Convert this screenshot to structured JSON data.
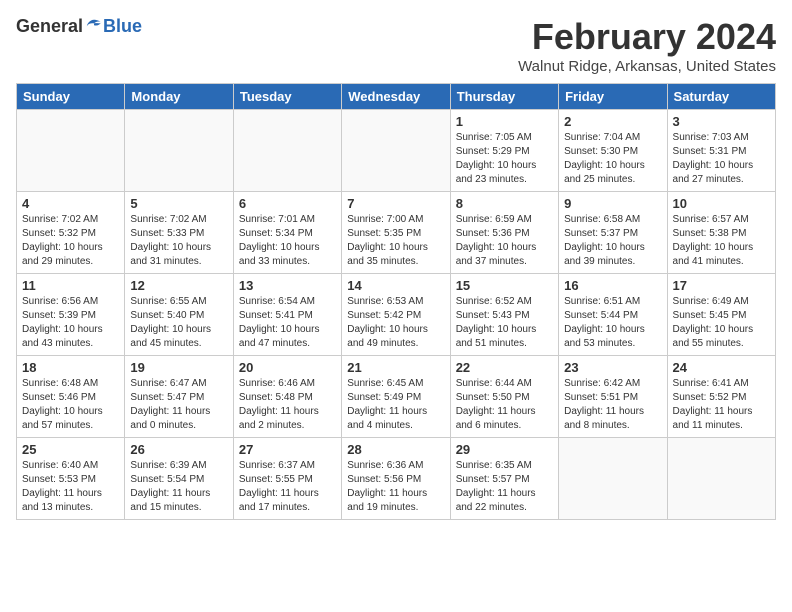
{
  "header": {
    "logo_general": "General",
    "logo_blue": "Blue",
    "month": "February 2024",
    "location": "Walnut Ridge, Arkansas, United States"
  },
  "weekdays": [
    "Sunday",
    "Monday",
    "Tuesday",
    "Wednesday",
    "Thursday",
    "Friday",
    "Saturday"
  ],
  "weeks": [
    [
      {
        "day": "",
        "info": ""
      },
      {
        "day": "",
        "info": ""
      },
      {
        "day": "",
        "info": ""
      },
      {
        "day": "",
        "info": ""
      },
      {
        "day": "1",
        "info": "Sunrise: 7:05 AM\nSunset: 5:29 PM\nDaylight: 10 hours\nand 23 minutes."
      },
      {
        "day": "2",
        "info": "Sunrise: 7:04 AM\nSunset: 5:30 PM\nDaylight: 10 hours\nand 25 minutes."
      },
      {
        "day": "3",
        "info": "Sunrise: 7:03 AM\nSunset: 5:31 PM\nDaylight: 10 hours\nand 27 minutes."
      }
    ],
    [
      {
        "day": "4",
        "info": "Sunrise: 7:02 AM\nSunset: 5:32 PM\nDaylight: 10 hours\nand 29 minutes."
      },
      {
        "day": "5",
        "info": "Sunrise: 7:02 AM\nSunset: 5:33 PM\nDaylight: 10 hours\nand 31 minutes."
      },
      {
        "day": "6",
        "info": "Sunrise: 7:01 AM\nSunset: 5:34 PM\nDaylight: 10 hours\nand 33 minutes."
      },
      {
        "day": "7",
        "info": "Sunrise: 7:00 AM\nSunset: 5:35 PM\nDaylight: 10 hours\nand 35 minutes."
      },
      {
        "day": "8",
        "info": "Sunrise: 6:59 AM\nSunset: 5:36 PM\nDaylight: 10 hours\nand 37 minutes."
      },
      {
        "day": "9",
        "info": "Sunrise: 6:58 AM\nSunset: 5:37 PM\nDaylight: 10 hours\nand 39 minutes."
      },
      {
        "day": "10",
        "info": "Sunrise: 6:57 AM\nSunset: 5:38 PM\nDaylight: 10 hours\nand 41 minutes."
      }
    ],
    [
      {
        "day": "11",
        "info": "Sunrise: 6:56 AM\nSunset: 5:39 PM\nDaylight: 10 hours\nand 43 minutes."
      },
      {
        "day": "12",
        "info": "Sunrise: 6:55 AM\nSunset: 5:40 PM\nDaylight: 10 hours\nand 45 minutes."
      },
      {
        "day": "13",
        "info": "Sunrise: 6:54 AM\nSunset: 5:41 PM\nDaylight: 10 hours\nand 47 minutes."
      },
      {
        "day": "14",
        "info": "Sunrise: 6:53 AM\nSunset: 5:42 PM\nDaylight: 10 hours\nand 49 minutes."
      },
      {
        "day": "15",
        "info": "Sunrise: 6:52 AM\nSunset: 5:43 PM\nDaylight: 10 hours\nand 51 minutes."
      },
      {
        "day": "16",
        "info": "Sunrise: 6:51 AM\nSunset: 5:44 PM\nDaylight: 10 hours\nand 53 minutes."
      },
      {
        "day": "17",
        "info": "Sunrise: 6:49 AM\nSunset: 5:45 PM\nDaylight: 10 hours\nand 55 minutes."
      }
    ],
    [
      {
        "day": "18",
        "info": "Sunrise: 6:48 AM\nSunset: 5:46 PM\nDaylight: 10 hours\nand 57 minutes."
      },
      {
        "day": "19",
        "info": "Sunrise: 6:47 AM\nSunset: 5:47 PM\nDaylight: 11 hours\nand 0 minutes."
      },
      {
        "day": "20",
        "info": "Sunrise: 6:46 AM\nSunset: 5:48 PM\nDaylight: 11 hours\nand 2 minutes."
      },
      {
        "day": "21",
        "info": "Sunrise: 6:45 AM\nSunset: 5:49 PM\nDaylight: 11 hours\nand 4 minutes."
      },
      {
        "day": "22",
        "info": "Sunrise: 6:44 AM\nSunset: 5:50 PM\nDaylight: 11 hours\nand 6 minutes."
      },
      {
        "day": "23",
        "info": "Sunrise: 6:42 AM\nSunset: 5:51 PM\nDaylight: 11 hours\nand 8 minutes."
      },
      {
        "day": "24",
        "info": "Sunrise: 6:41 AM\nSunset: 5:52 PM\nDaylight: 11 hours\nand 11 minutes."
      }
    ],
    [
      {
        "day": "25",
        "info": "Sunrise: 6:40 AM\nSunset: 5:53 PM\nDaylight: 11 hours\nand 13 minutes."
      },
      {
        "day": "26",
        "info": "Sunrise: 6:39 AM\nSunset: 5:54 PM\nDaylight: 11 hours\nand 15 minutes."
      },
      {
        "day": "27",
        "info": "Sunrise: 6:37 AM\nSunset: 5:55 PM\nDaylight: 11 hours\nand 17 minutes."
      },
      {
        "day": "28",
        "info": "Sunrise: 6:36 AM\nSunset: 5:56 PM\nDaylight: 11 hours\nand 19 minutes."
      },
      {
        "day": "29",
        "info": "Sunrise: 6:35 AM\nSunset: 5:57 PM\nDaylight: 11 hours\nand 22 minutes."
      },
      {
        "day": "",
        "info": ""
      },
      {
        "day": "",
        "info": ""
      }
    ]
  ]
}
